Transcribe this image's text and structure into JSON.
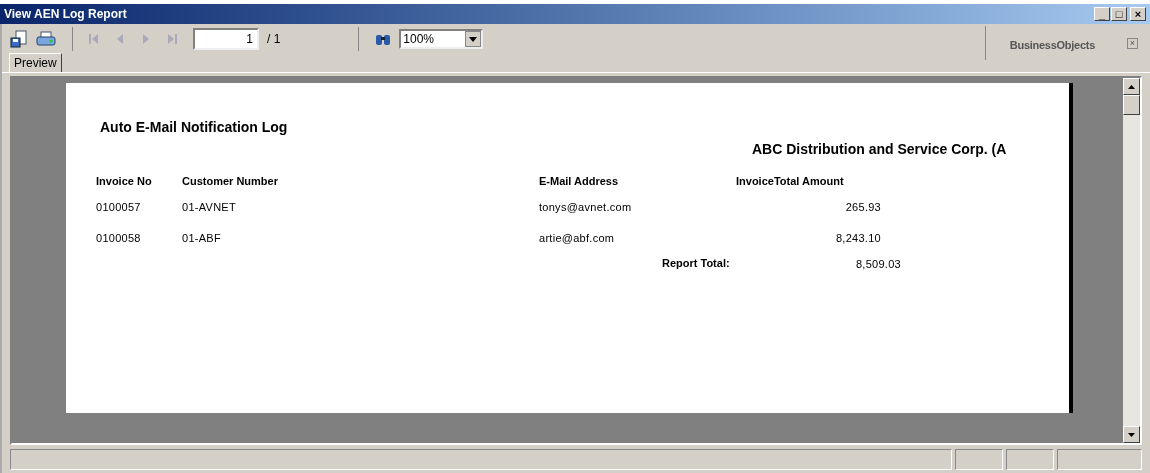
{
  "window": {
    "title": "View AEN Log Report",
    "controls": [
      "_",
      "□",
      "×"
    ]
  },
  "toolbar": {
    "page_field": {
      "value": "1"
    },
    "page_count": "/ 1",
    "zoom": {
      "value": "100%"
    },
    "logo": "Business**Objects**",
    "close": "×"
  },
  "tabs": [
    {
      "label": "Preview",
      "selected": true
    }
  ],
  "report": {
    "title": "Auto E-Mail Notification Log",
    "company": "ABC Distribution and Service Corp. (A",
    "columns": [
      "Invoice No",
      "Customer Number",
      "E-Mail Address",
      "InvoiceTotal Amount"
    ],
    "rows": [
      {
        "invoice_no": "0100057",
        "customer": "01-AVNET",
        "email": "tonys@avnet.com",
        "amount": "265.93"
      },
      {
        "invoice_no": "0100058",
        "customer": "01-ABF",
        "email": "artie@abf.com",
        "amount": "8,243.10"
      }
    ],
    "total_label": "Report Total:",
    "total": "8,509.03"
  }
}
